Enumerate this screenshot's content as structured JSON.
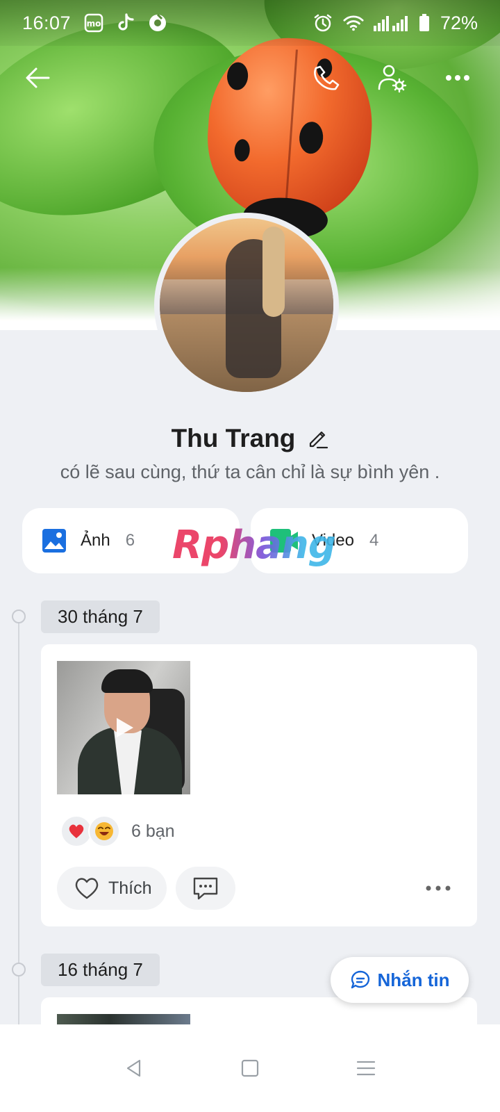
{
  "status_bar": {
    "time": "16:07",
    "notification_icons": [
      "momo-icon",
      "tiktok-icon",
      "app-icon"
    ],
    "battery": "72%"
  },
  "header": {
    "back": "back-arrow-icon",
    "call": "phone-icon",
    "settings": "user-settings-icon",
    "more": "more-horizontal-icon"
  },
  "profile": {
    "name": "Thu Trang",
    "bio": "có lẽ sau cùng,  thứ ta cân chỉ là sự bình yên ."
  },
  "media": {
    "photos": {
      "label": "Ảnh",
      "count": "6"
    },
    "videos": {
      "label": "Video",
      "count": "4"
    }
  },
  "watermark": "Rphang",
  "timeline": [
    {
      "date": "30 tháng 7",
      "reaction_count": "6 bạn",
      "reactions": [
        "heart",
        "laugh"
      ],
      "like_label": "Thích"
    },
    {
      "date": "16 tháng 7"
    }
  ],
  "chat_button": {
    "label": "Nhắn tin"
  },
  "colors": {
    "accent": "#1565d8",
    "background": "#eef0f4",
    "heart": "#e8323c",
    "video_icon": "#1ec07a"
  }
}
